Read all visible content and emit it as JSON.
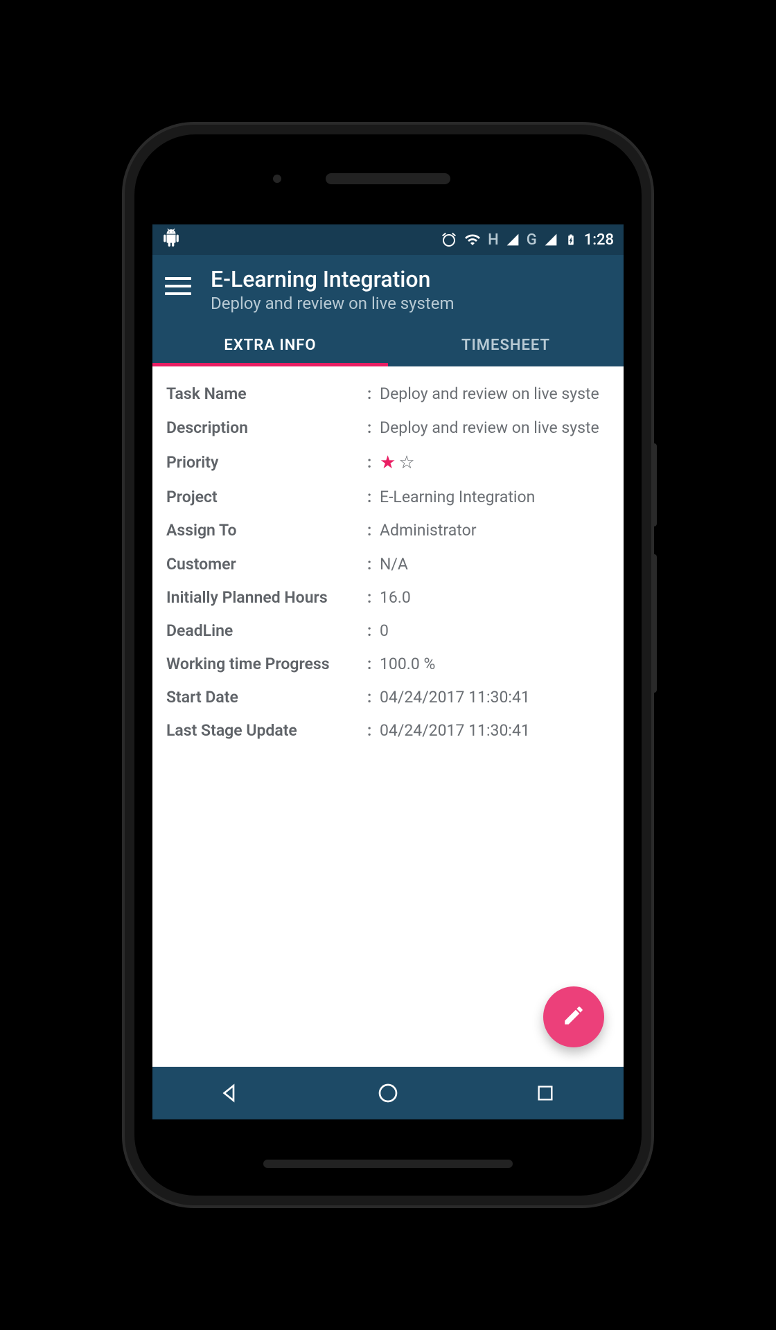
{
  "status": {
    "time": "1:28",
    "network1": "H",
    "network2": "G"
  },
  "header": {
    "title": "E-Learning Integration",
    "subtitle": "Deploy and review on live system"
  },
  "tabs": {
    "extra_info": "EXTRA INFO",
    "timesheet": "TIMESHEET"
  },
  "info": {
    "task_name_label": "Task Name",
    "task_name_value": "Deploy and review on live syste",
    "description_label": "Description",
    "description_value": "Deploy and review on live syste",
    "priority_label": "Priority",
    "priority_stars_filled": 1,
    "priority_stars_total": 2,
    "project_label": "Project",
    "project_value": "E-Learning Integration",
    "assign_to_label": "Assign To",
    "assign_to_value": "Administrator",
    "customer_label": "Customer",
    "customer_value": "N/A",
    "planned_hours_label": "Initially Planned Hours",
    "planned_hours_value": "16.0",
    "deadline_label": "DeadLine",
    "deadline_value": "0",
    "progress_label": "Working time Progress",
    "progress_value": "100.0 %",
    "start_date_label": "Start Date",
    "start_date_value": "04/24/2017 11:30:41",
    "last_stage_label": "Last Stage Update",
    "last_stage_value": "04/24/2017 11:30:41"
  }
}
